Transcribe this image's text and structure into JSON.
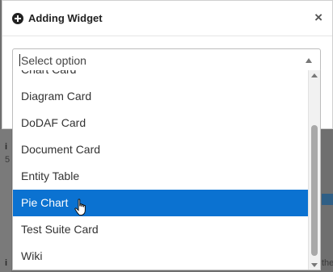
{
  "dialog": {
    "title": "Adding Widget",
    "select_placeholder": "Select option"
  },
  "dropdown": {
    "items": [
      {
        "label": "Chart Card",
        "selected": false
      },
      {
        "label": "Diagram Card",
        "selected": false
      },
      {
        "label": "DoDAF Card",
        "selected": false
      },
      {
        "label": "Document Card",
        "selected": false
      },
      {
        "label": "Entity Table",
        "selected": false
      },
      {
        "label": "Pie Chart",
        "selected": true
      },
      {
        "label": "Test Suite Card",
        "selected": false
      },
      {
        "label": "Wiki",
        "selected": false
      }
    ]
  },
  "background": {
    "fragment_1": "i",
    "fragment_2": "5",
    "fragment_3": "i",
    "fragment_4": "the"
  },
  "colors": {
    "highlight": "#0b72d1",
    "overlay": "#6f6f6f"
  }
}
